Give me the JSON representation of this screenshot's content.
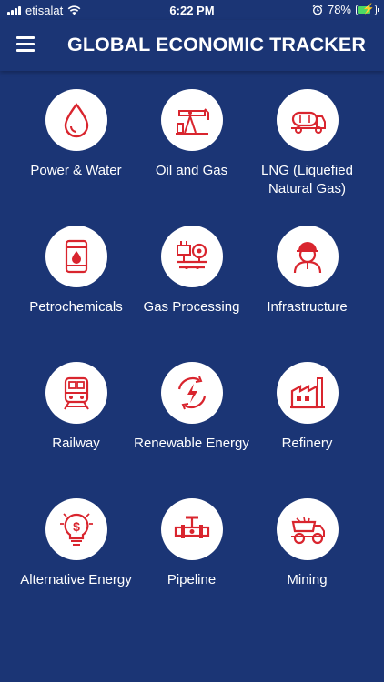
{
  "status_bar": {
    "carrier": "etisalat",
    "time": "6:22 PM",
    "battery_percent": "78%",
    "battery_level": 0.78,
    "battery_charging": true,
    "icons": [
      "signal-icon",
      "wifi-icon",
      "alarm-icon",
      "battery-icon"
    ]
  },
  "header": {
    "title": "GLOBAL ECONOMIC TRACKER",
    "menu_icon": "hamburger-menu-icon"
  },
  "colors": {
    "background": "#1b3575",
    "icon_accent": "#d9252e",
    "tile_circle": "#ffffff",
    "text": "#ffffff"
  },
  "categories": [
    {
      "label": "Power & Water",
      "icon": "water-drop-icon"
    },
    {
      "label": "Oil and Gas",
      "icon": "oil-pump-icon"
    },
    {
      "label": "LNG (Liquefied Natural Gas)",
      "icon": "tanker-truck-icon"
    },
    {
      "label": "Petrochemicals",
      "icon": "oil-barrel-icon"
    },
    {
      "label": "Gas Processing",
      "icon": "gas-processing-icon"
    },
    {
      "label": "Infrastructure",
      "icon": "engineer-icon"
    },
    {
      "label": "Railway",
      "icon": "train-icon"
    },
    {
      "label": "Renewable Energy",
      "icon": "renewable-energy-icon"
    },
    {
      "label": "Refinery",
      "icon": "factory-icon"
    },
    {
      "label": "Alternative Energy",
      "icon": "dollar-bulb-icon"
    },
    {
      "label": "Pipeline",
      "icon": "pipeline-icon"
    },
    {
      "label": "Mining",
      "icon": "mining-truck-icon"
    }
  ]
}
